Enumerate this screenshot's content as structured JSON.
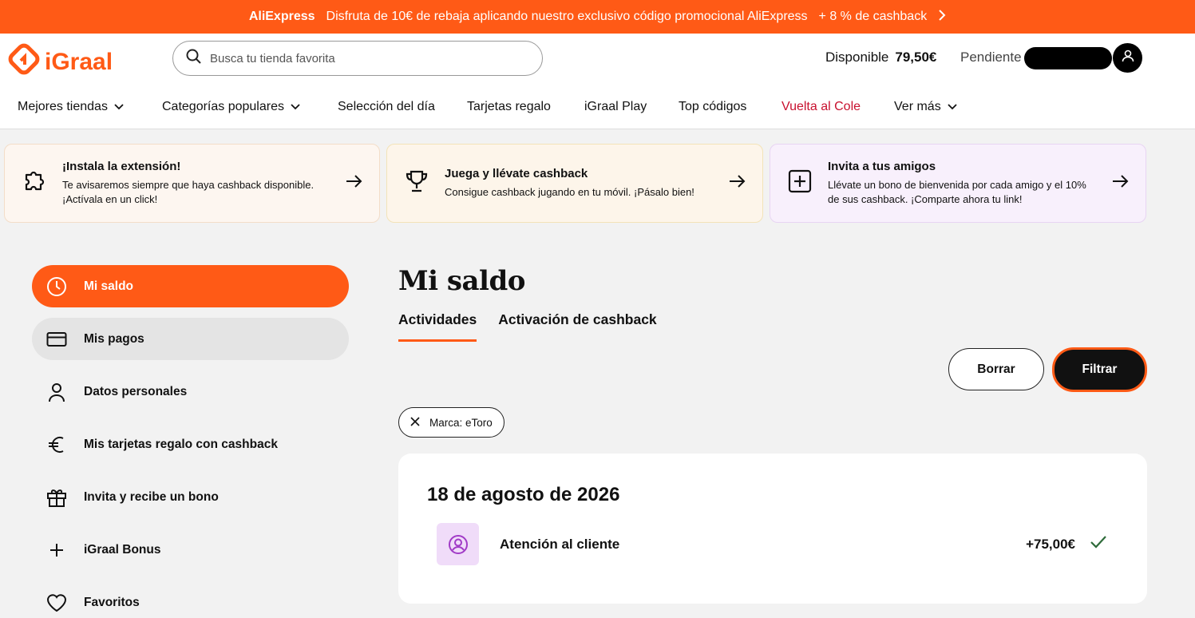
{
  "promo": {
    "brand": "AliExpress",
    "text": "Disfruta de 10€ de rebaja aplicando nuestro exclusivo código promocional AliExpress",
    "extra": "+ 8 % de cashback"
  },
  "header": {
    "logo_text": "iGraal",
    "search_placeholder": "Busca tu tienda favorita",
    "available_label": "Disponible",
    "available_amount": "79,50€",
    "pending_label": "Pendiente"
  },
  "nav": [
    {
      "label": "Mejores tiendas",
      "dropdown": true
    },
    {
      "label": "Categorías populares",
      "dropdown": true
    },
    {
      "label": "Selección del día",
      "dropdown": false
    },
    {
      "label": "Tarjetas regalo",
      "dropdown": false
    },
    {
      "label": "iGraal Play",
      "dropdown": false
    },
    {
      "label": "Top códigos",
      "dropdown": false
    },
    {
      "label": "Vuelta al Cole",
      "dropdown": false,
      "highlight": "#c8102e"
    },
    {
      "label": "Ver más",
      "dropdown": true
    }
  ],
  "cards": [
    {
      "title": "¡Instala la extensión!",
      "desc": "Te avisaremos siempre que haya cashback disponible. ¡Actívala en un click!",
      "icon": "puzzle-icon",
      "bg": "#fdf6f0"
    },
    {
      "title": "Juega y llévate cashback",
      "desc": "Consigue cashback jugando en tu móvil. ¡Pásalo bien!",
      "icon": "trophy-icon",
      "bg": "#fdf5ea"
    },
    {
      "title": "Invita a tus amigos",
      "desc": "Llévate un bono de bienvenida por cada amigo y el 10% de sus cashback. ¡Comparte ahora tu link!",
      "icon": "plus-square-icon",
      "bg": "#f8f0fc"
    }
  ],
  "sidebar": [
    {
      "label": "Mi saldo",
      "icon": "clock-icon",
      "state": "active"
    },
    {
      "label": "Mis pagos",
      "icon": "card-icon",
      "state": "hover"
    },
    {
      "label": "Datos personales",
      "icon": "user-icon",
      "state": ""
    },
    {
      "label": "Mis tarjetas regalo con cashback",
      "icon": "euro-icon",
      "state": ""
    },
    {
      "label": "Invita y recibe un bono",
      "icon": "gift-icon",
      "state": ""
    },
    {
      "label": "iGraal Bonus",
      "icon": "plus-icon",
      "state": ""
    },
    {
      "label": "Favoritos",
      "icon": "heart-icon",
      "state": ""
    }
  ],
  "main": {
    "title": "Mi saldo",
    "tabs": [
      {
        "label": "Actividades",
        "selected": true
      },
      {
        "label": "Activación de cashback",
        "selected": false
      }
    ],
    "clear_label": "Borrar",
    "filter_label": "Filtrar",
    "chip_label": "Marca: eToro",
    "date": "18 de agosto de 2026",
    "transaction": {
      "name": "Atención al cliente",
      "amount": "+75,00€",
      "status_icon": "check-icon"
    }
  },
  "colors": {
    "accent": "#ff5a16",
    "check": "#2e6b3a"
  }
}
